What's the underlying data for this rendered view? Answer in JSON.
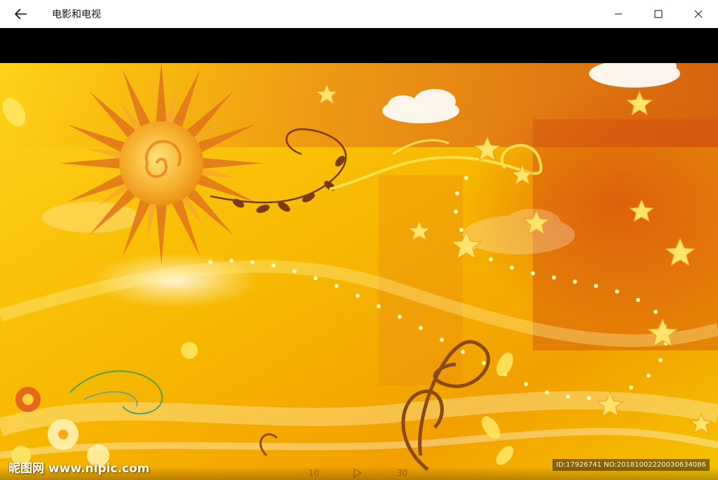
{
  "app": {
    "title": "电影和电视"
  },
  "window_controls": {
    "back": "back-arrow-icon",
    "minimize": "minimize-icon",
    "maximize": "maximize-icon",
    "close": "close-icon"
  },
  "video": {
    "watermark_site": "昵图网 www.nipic.com",
    "watermark_id": "ID:17926741 NO:20181002220030634086",
    "skip_back_label": "10",
    "skip_forward_label": "30",
    "colors": {
      "background": "#f5b800",
      "accent_orange": "#e8761a",
      "vine_brown": "#7a3a12",
      "sun": "#f7a41c"
    }
  }
}
